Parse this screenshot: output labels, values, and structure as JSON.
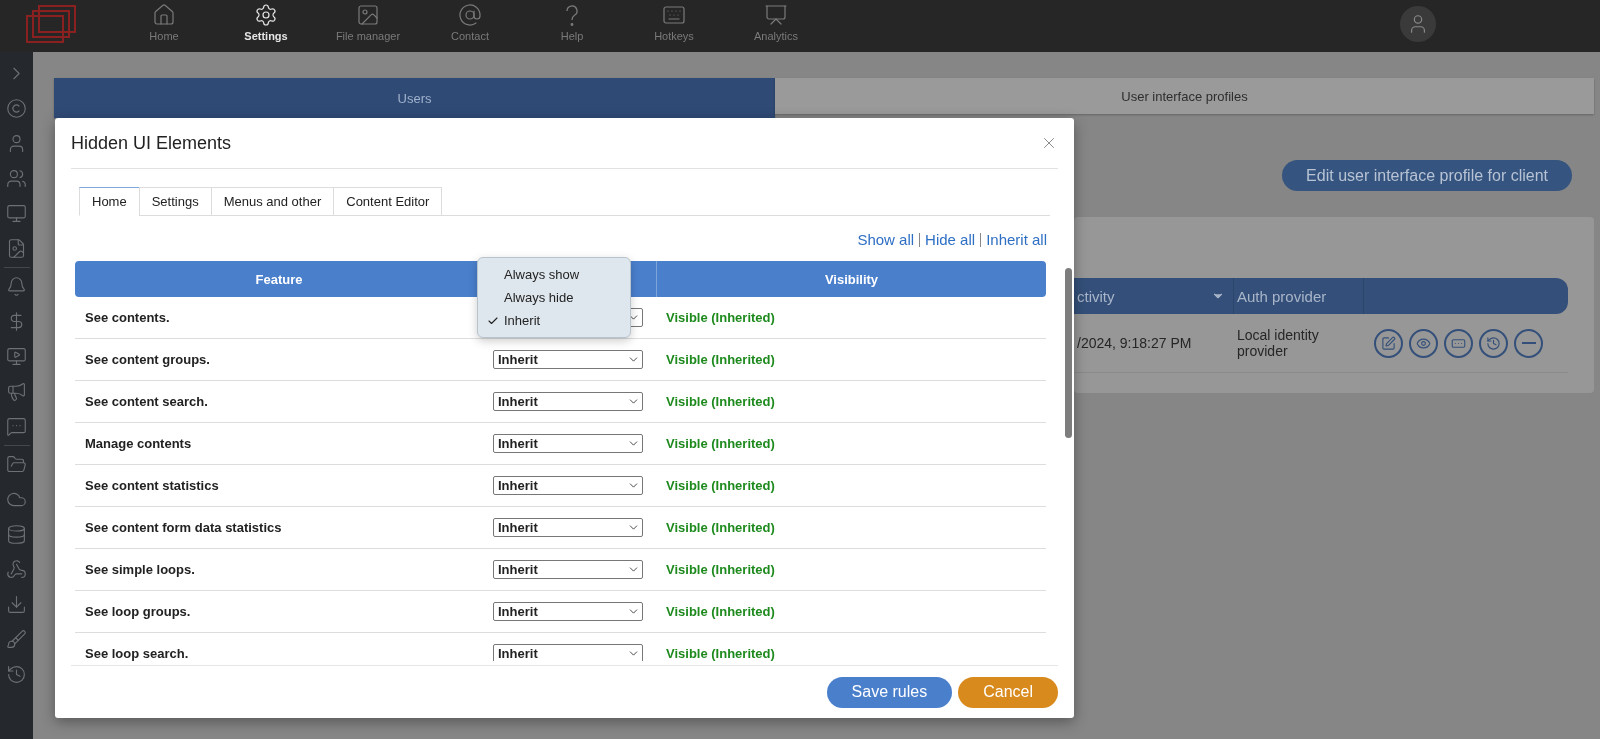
{
  "nav": {
    "items": [
      {
        "label": "Home",
        "selected": false
      },
      {
        "label": "Settings",
        "selected": true
      },
      {
        "label": "File manager",
        "selected": false
      },
      {
        "label": "Contact",
        "selected": false
      },
      {
        "label": "Help",
        "selected": false
      },
      {
        "label": "Hotkeys",
        "selected": false
      },
      {
        "label": "Analytics",
        "selected": false
      }
    ]
  },
  "background": {
    "tabs": [
      {
        "label": "Users",
        "selected": true
      },
      {
        "label": "User interface profiles",
        "selected": false
      }
    ],
    "edit_button": "Edit user interface profile for client",
    "table": {
      "columns": [
        "ctivity",
        "Auth provider"
      ],
      "rows": [
        {
          "cells": [
            "/2024, 9:18:27 PM",
            "Local identity provider"
          ]
        }
      ]
    }
  },
  "dialog": {
    "title": "Hidden UI Elements",
    "tabs": [
      {
        "label": "Home",
        "selected": true
      },
      {
        "label": "Settings",
        "selected": false
      },
      {
        "label": "Menus and other",
        "selected": false
      },
      {
        "label": "Content Editor",
        "selected": false
      }
    ],
    "links": [
      "Show all",
      "Hide all",
      "Inherit all"
    ],
    "header": {
      "feature": "Feature",
      "visibility": "Visibility"
    },
    "rows": [
      {
        "feature": "See contents.",
        "visibility": "Visible (Inherited)"
      },
      {
        "feature": "See content groups.",
        "setting": "Inherit",
        "visibility": "Visible (Inherited)"
      },
      {
        "feature": "See content search.",
        "setting": "Inherit",
        "visibility": "Visible (Inherited)"
      },
      {
        "feature": "Manage contents",
        "setting": "Inherit",
        "visibility": "Visible (Inherited)"
      },
      {
        "feature": "See content statistics",
        "setting": "Inherit",
        "visibility": "Visible (Inherited)"
      },
      {
        "feature": "See content form data statistics",
        "setting": "Inherit",
        "visibility": "Visible (Inherited)"
      },
      {
        "feature": "See simple loops.",
        "setting": "Inherit",
        "visibility": "Visible (Inherited)"
      },
      {
        "feature": "See loop groups.",
        "setting": "Inherit",
        "visibility": "Visible (Inherited)"
      },
      {
        "feature": "See loop search.",
        "setting": "Inherit",
        "visibility": "Visible (Inherited)"
      }
    ],
    "dropdown": {
      "options": [
        {
          "label": "Always show",
          "selected": false
        },
        {
          "label": "Always hide",
          "selected": false
        },
        {
          "label": "Inherit",
          "selected": true
        }
      ]
    },
    "buttons": [
      {
        "label": "Save rules",
        "kind": "primary"
      },
      {
        "label": "Cancel",
        "kind": "cancel"
      }
    ]
  }
}
